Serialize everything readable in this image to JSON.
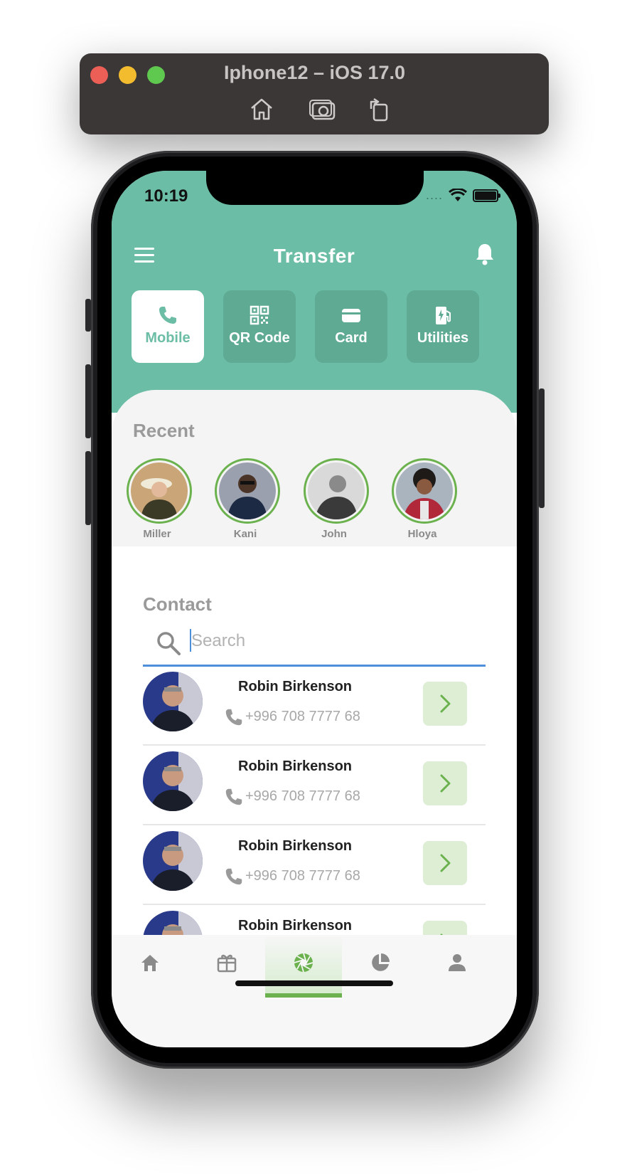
{
  "simulator": {
    "title": "Iphone12 – iOS 17.0"
  },
  "status_bar": {
    "time": "10:19",
    "signal_dots": "....",
    "icons": [
      "wifi-icon",
      "battery-icon"
    ]
  },
  "header": {
    "title": "Transfer"
  },
  "tiles": [
    {
      "label": "Mobile",
      "icon": "phone-icon",
      "active": true
    },
    {
      "label": "QR Code",
      "icon": "qr-code-icon",
      "active": false
    },
    {
      "label": "Card",
      "icon": "card-icon",
      "active": false
    },
    {
      "label": "Utilities",
      "icon": "utilities-icon",
      "active": false
    }
  ],
  "recent": {
    "title": "Recent",
    "people": [
      {
        "name": "Miller"
      },
      {
        "name": "Kani"
      },
      {
        "name": "John"
      },
      {
        "name": "Hloya"
      }
    ]
  },
  "contact": {
    "title": "Contact",
    "search_placeholder": "Search",
    "list": [
      {
        "name": "Robin Birkenson",
        "phone": "+996 708 7777 68"
      },
      {
        "name": "Robin Birkenson",
        "phone": "+996 708 7777 68"
      },
      {
        "name": "Robin Birkenson",
        "phone": "+996 708 7777 68"
      },
      {
        "name": "Robin Birkenson",
        "phone": ""
      }
    ]
  },
  "bottom_nav": [
    {
      "icon": "home-icon",
      "active": false
    },
    {
      "icon": "gift-icon",
      "active": false
    },
    {
      "icon": "aperture-icon",
      "active": true
    },
    {
      "icon": "pie-chart-icon",
      "active": false
    },
    {
      "icon": "profile-icon",
      "active": false
    }
  ],
  "colors": {
    "brand": "#6bbda5",
    "accent_green": "#6bb24f",
    "search_underline": "#4e8fdc"
  }
}
